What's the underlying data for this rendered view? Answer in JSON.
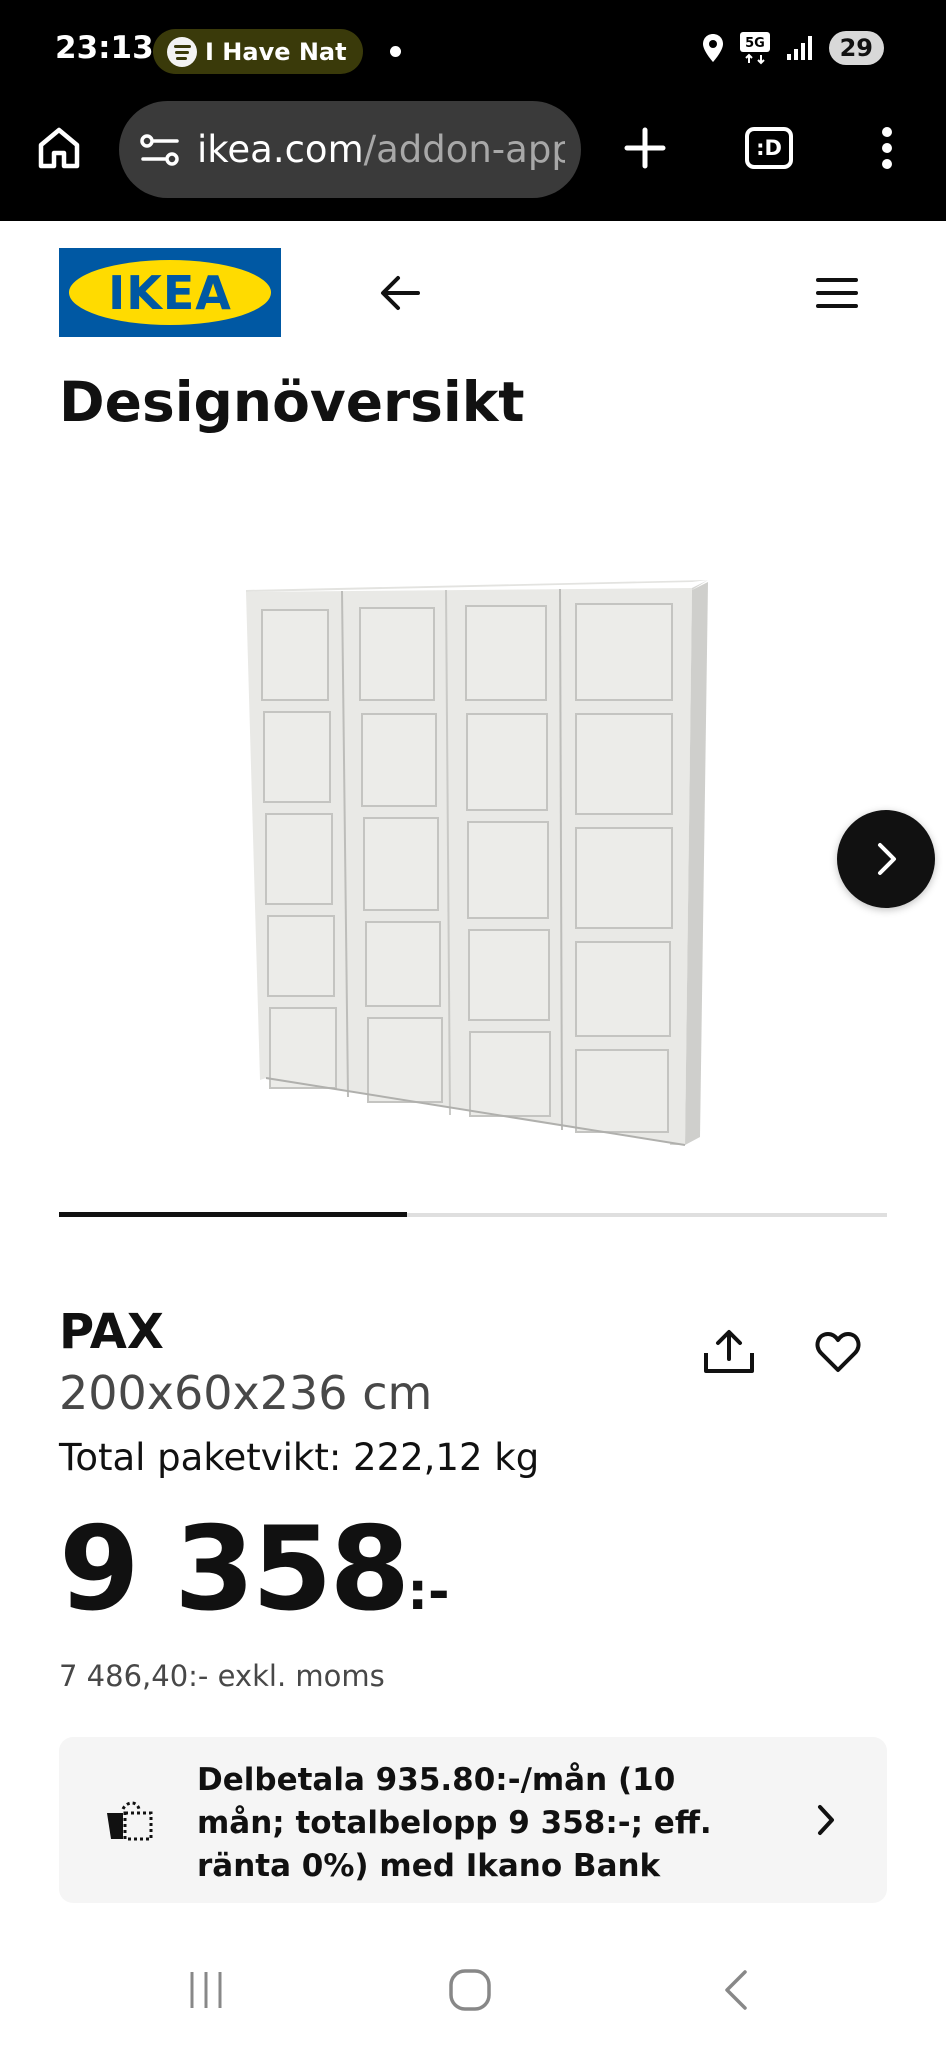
{
  "status_bar": {
    "time": "23:13",
    "media_title": "I Have Nat",
    "network": "5G",
    "battery": "29",
    "icons": [
      "spotify-icon",
      "location-icon",
      "5g-icon",
      "signal-icon",
      "battery-icon"
    ]
  },
  "browser": {
    "url_domain": "ikea.com",
    "url_path": "/addon-app",
    "tab_count": ":D",
    "icons": [
      "home-icon",
      "site-settings-icon",
      "new-tab-icon",
      "overflow-menu-icon"
    ]
  },
  "header": {
    "logo_text": "IKEA",
    "icons": [
      "back-arrow-icon",
      "hamburger-menu-icon"
    ]
  },
  "page_title": "Designöversikt",
  "gallery": {
    "image_subject": "PAX wardrobe",
    "progress_fraction": 0.42,
    "icons": [
      "chevron-right-icon"
    ]
  },
  "product": {
    "name": "PAX",
    "dimensions": "200x60x236 cm",
    "weight": "Total paketvikt: 222,12 kg",
    "price_main": "9 358",
    "price_suffix": ":-",
    "price_excl_vat": "7 486,40:- exkl. moms",
    "icons": [
      "share-icon",
      "heart-icon"
    ]
  },
  "financing": {
    "text": "Delbetala 935.80:-/mån (10 mån; totalbelopp 9 358:-; eff. ränta 0%) med Ikano Bank",
    "icons": [
      "installment-icon",
      "chevron-right-icon"
    ]
  },
  "nav": {
    "icons": [
      "recent-apps-icon",
      "home-circle-icon",
      "back-icon"
    ]
  },
  "colors": {
    "ikea_blue": "#0058a3",
    "ikea_yellow": "#ffdb00",
    "chrome_bg": "#000000",
    "finance_bg": "#f5f5f5"
  }
}
